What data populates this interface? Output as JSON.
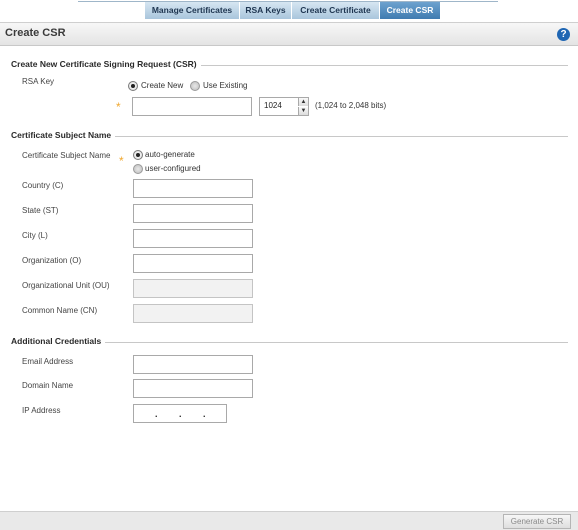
{
  "tabs": [
    {
      "label": "Manage Certificates"
    },
    {
      "label": "RSA Keys"
    },
    {
      "label": "Create Certificate"
    },
    {
      "label": "Create CSR"
    }
  ],
  "header": {
    "title": "Create CSR",
    "help_glyph": "?"
  },
  "csr_section": {
    "title": "Create New Certificate Signing Request (CSR)",
    "rsa_key_label": "RSA Key",
    "create_new_label": "Create New",
    "use_existing_label": "Use Existing",
    "rsa_key_selected": "Create New",
    "key_name_value": "",
    "key_size_value": "1024",
    "key_size_hint": "(1,024 to 2,048 bits)",
    "required_mark": "*"
  },
  "subject_section": {
    "title": "Certificate Subject Name",
    "subject_label": "Certificate Subject Name",
    "auto_label": "auto-generate",
    "user_label": "user-configured",
    "selected": "auto-generate",
    "required_mark": "*",
    "country_label": "Country (C)",
    "state_label": "State (ST)",
    "city_label": "City (L)",
    "org_label": "Organization (O)",
    "org_unit_label": "Organizational Unit (OU)",
    "common_name_label": "Common Name (CN)"
  },
  "credentials_section": {
    "title": "Additional Credentials",
    "email_label": "Email Address",
    "domain_label": "Domain Name",
    "ip_label": "IP Address",
    "ip_dot": "."
  },
  "footer": {
    "generate_label": "Generate CSR"
  },
  "colors": {
    "tab_active": "#4a86bb",
    "help_icon": "#1f66b3",
    "required_star": "#f0a830"
  }
}
